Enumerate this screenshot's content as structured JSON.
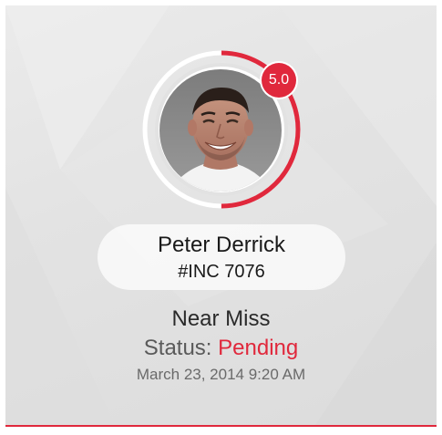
{
  "profile": {
    "name": "Peter Derrick",
    "rating": "5.0",
    "rating_fraction": 0.5
  },
  "incident": {
    "id": "#INC 7076",
    "type": "Near Miss",
    "status_label": "Status:",
    "status_value": "Pending",
    "timestamp": "March 23, 2014 9:20 AM"
  },
  "colors": {
    "accent": "#e0283c",
    "card_background": "#e4e4e4",
    "ring_track": "#ffffff"
  },
  "icons": {
    "avatar": "user-photo"
  }
}
